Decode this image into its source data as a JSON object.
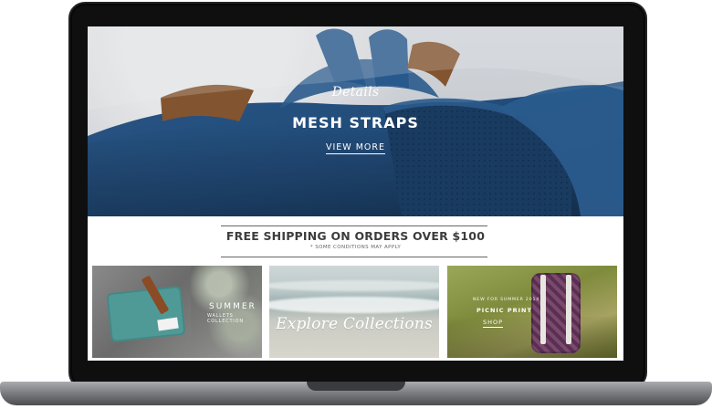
{
  "hero": {
    "kicker": "Details",
    "title": "MESH STRAPS",
    "cta": "VIEW MORE"
  },
  "shipping": {
    "main": "FREE SHIPPING ON ORDERS OVER $100",
    "sub": "* SOME CONDITIONS MAY APPLY"
  },
  "tiles": [
    {
      "name": "summer",
      "title": "SUMMER",
      "subtitle": "WALLETS COLLECTION"
    },
    {
      "name": "explore",
      "title": "Explore Collections"
    },
    {
      "name": "picnic",
      "kicker": "NEW FOR SUMMER 2014",
      "title": "PICNIC PRINT",
      "cta": "SHOP"
    }
  ],
  "icons": {
    "tile1": "pouch-icon",
    "tile2": "wave-icon",
    "tile3": "backpack-icon"
  }
}
